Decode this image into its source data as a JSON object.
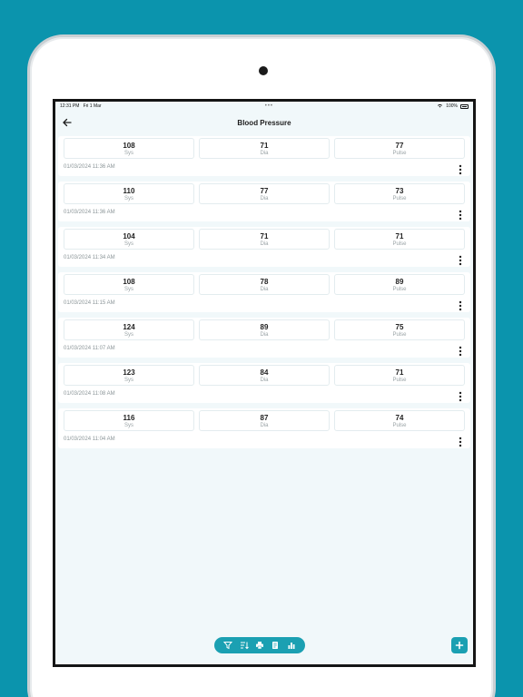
{
  "status_bar": {
    "time": "12:31 PM",
    "date": "Fri 1 Mar",
    "battery": "100%"
  },
  "header": {
    "title": "Blood Pressure"
  },
  "labels": {
    "sys": "Sys",
    "dia": "Dia",
    "pulse": "Pulse"
  },
  "records": [
    {
      "sys": "108",
      "dia": "71",
      "pulse": "77",
      "timestamp": "01/03/2024  11:36 AM"
    },
    {
      "sys": "110",
      "dia": "77",
      "pulse": "73",
      "timestamp": "01/03/2024  11:36 AM"
    },
    {
      "sys": "104",
      "dia": "71",
      "pulse": "71",
      "timestamp": "01/03/2024  11:34 AM"
    },
    {
      "sys": "108",
      "dia": "78",
      "pulse": "89",
      "timestamp": "01/03/2024  11:15 AM"
    },
    {
      "sys": "124",
      "dia": "89",
      "pulse": "75",
      "timestamp": "01/03/2024  11:07 AM"
    },
    {
      "sys": "123",
      "dia": "84",
      "pulse": "71",
      "timestamp": "01/03/2024  11:08 AM"
    },
    {
      "sys": "116",
      "dia": "87",
      "pulse": "74",
      "timestamp": "01/03/2024  11:04 AM"
    }
  ],
  "toolbar": {
    "icons": [
      "filter-icon",
      "sort-icon",
      "print-icon",
      "report-icon",
      "chart-icon"
    ]
  },
  "fab": {
    "icon": "plus-icon"
  },
  "colors": {
    "background": "#0b94ad",
    "accent": "#1ba0b2",
    "screen_bg": "#f1f8fa"
  }
}
